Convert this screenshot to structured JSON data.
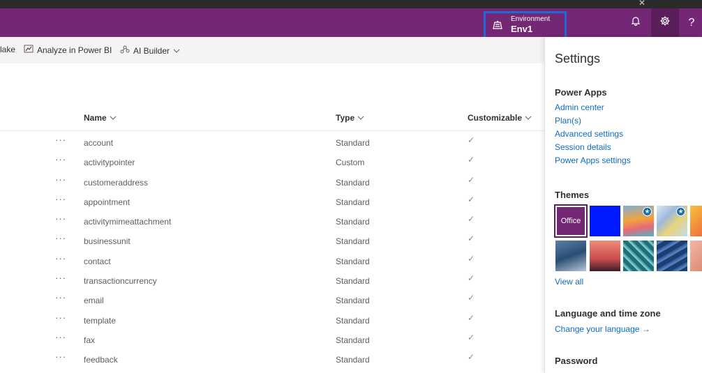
{
  "topbar": {
    "environment_label": "Environment",
    "environment_name": "Env1",
    "help_label": "?",
    "brand_color": "#742774",
    "highlight_color": "#1e6bd6"
  },
  "commandbar": {
    "items": [
      {
        "label": "lake",
        "icon": "none"
      },
      {
        "label": "Analyze in Power BI",
        "icon": "power-bi-icon"
      },
      {
        "label": "AI Builder",
        "icon": "ai-builder-icon"
      }
    ]
  },
  "table": {
    "columns": [
      {
        "label": "Name"
      },
      {
        "label": "Type"
      },
      {
        "label": "Customizable"
      }
    ],
    "rows": [
      {
        "name": "account",
        "type": "Standard",
        "customizable": "✓"
      },
      {
        "name": "activitypointer",
        "type": "Custom",
        "customizable": "✓"
      },
      {
        "name": "customeraddress",
        "type": "Standard",
        "customizable": "✓"
      },
      {
        "name": "appointment",
        "type": "Standard",
        "customizable": "✓"
      },
      {
        "name": "activitymimeattachment",
        "type": "Standard",
        "customizable": "✓"
      },
      {
        "name": "businessunit",
        "type": "Standard",
        "customizable": "✓"
      },
      {
        "name": "contact",
        "type": "Standard",
        "customizable": "✓"
      },
      {
        "name": "transactioncurrency",
        "type": "Standard",
        "customizable": "✓"
      },
      {
        "name": "email",
        "type": "Standard",
        "customizable": "✓"
      },
      {
        "name": "template",
        "type": "Standard",
        "customizable": "✓"
      },
      {
        "name": "fax",
        "type": "Standard",
        "customizable": "✓"
      },
      {
        "name": "feedback",
        "type": "Standard",
        "customizable": "✓"
      }
    ]
  },
  "settings": {
    "title": "Settings",
    "power_apps": {
      "heading": "Power Apps",
      "links": [
        "Admin center",
        "Plan(s)",
        "Advanced settings",
        "Session details",
        "Power Apps settings"
      ]
    },
    "themes": {
      "heading": "Themes",
      "office_label": "Office",
      "view_all": "View all"
    },
    "language": {
      "heading": "Language and time zone",
      "link": "Change your language →"
    },
    "password": {
      "heading": "Password"
    }
  }
}
